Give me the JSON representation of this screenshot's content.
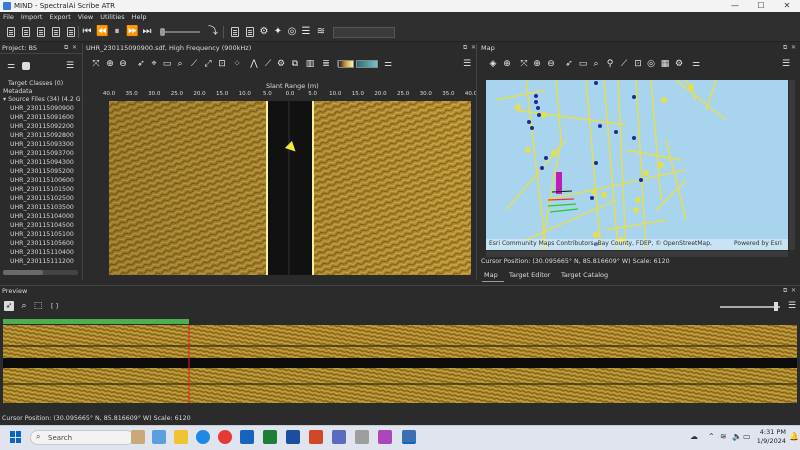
{
  "window": {
    "title": "MIND - SpectralAi Scribe ATR",
    "controls": [
      "—",
      "☐",
      "✕"
    ]
  },
  "menu": [
    "File",
    "Import",
    "Export",
    "View",
    "Utilities",
    "Help"
  ],
  "project_panel": {
    "title": "Project: BS",
    "items": [
      "Target Classes (0)",
      "Metadata",
      "▾ Source Files (34) (4.2 G",
      "UHR_230115090900",
      "UHR_230115091600",
      "UHR_230115092200",
      "UHR_230115092800",
      "UHR_230115093300",
      "UHR_230115093700",
      "UHR_230115094300",
      "UHR_230115095200",
      "UHR_230115100600",
      "UHR_230115101500",
      "UHR_230115102500",
      "UHR_230115103500",
      "UHR_230115104000",
      "UHR_230115104500",
      "UHR_230115105100",
      "UHR_230115105600",
      "UHR_230115110400",
      "UHR_230115111200"
    ]
  },
  "sonar_panel": {
    "title": "UHR_230115090900.sdf, High Frequency (900kHz)",
    "axis_label": "Slant Range (m)",
    "ticks": [
      "40.0",
      "35.0",
      "30.0",
      "25.0",
      "20.0",
      "15.0",
      "10.0",
      "5.0",
      "0.0",
      "5.0",
      "10.0",
      "15.0",
      "20.0",
      "25.0",
      "30.0",
      "35.0",
      "40.0"
    ]
  },
  "map_panel": {
    "title": "Map",
    "attribution": "Esri Community Maps Contributors, Bay County, FDEP, © OpenStreetMap,",
    "powered_by": "Powered by Esri",
    "cursor_position": "Cursor Position: (30.095665°  N, 85.816609°  W)  Scale: 6120",
    "tabs": [
      "Map",
      "Target Editor",
      "Target Catalog"
    ]
  },
  "preview_panel": {
    "title": "Preview",
    "bracket_label": "[ ]"
  },
  "status_bar": {
    "cursor_position": "Cursor Position: (30.095665°  N, 85.816609°  W)  Scale: 6120"
  },
  "taskbar": {
    "search_placeholder": "Search",
    "time": "4:31 PM",
    "date": "1/9/2024"
  },
  "colors": {
    "sonar_gold": "#b8902f",
    "map_water": "#a9d4ee",
    "road_yellow": "#e8e24a",
    "marker_blue": "#1f2a9a",
    "preview_progress": "#4caf50"
  }
}
